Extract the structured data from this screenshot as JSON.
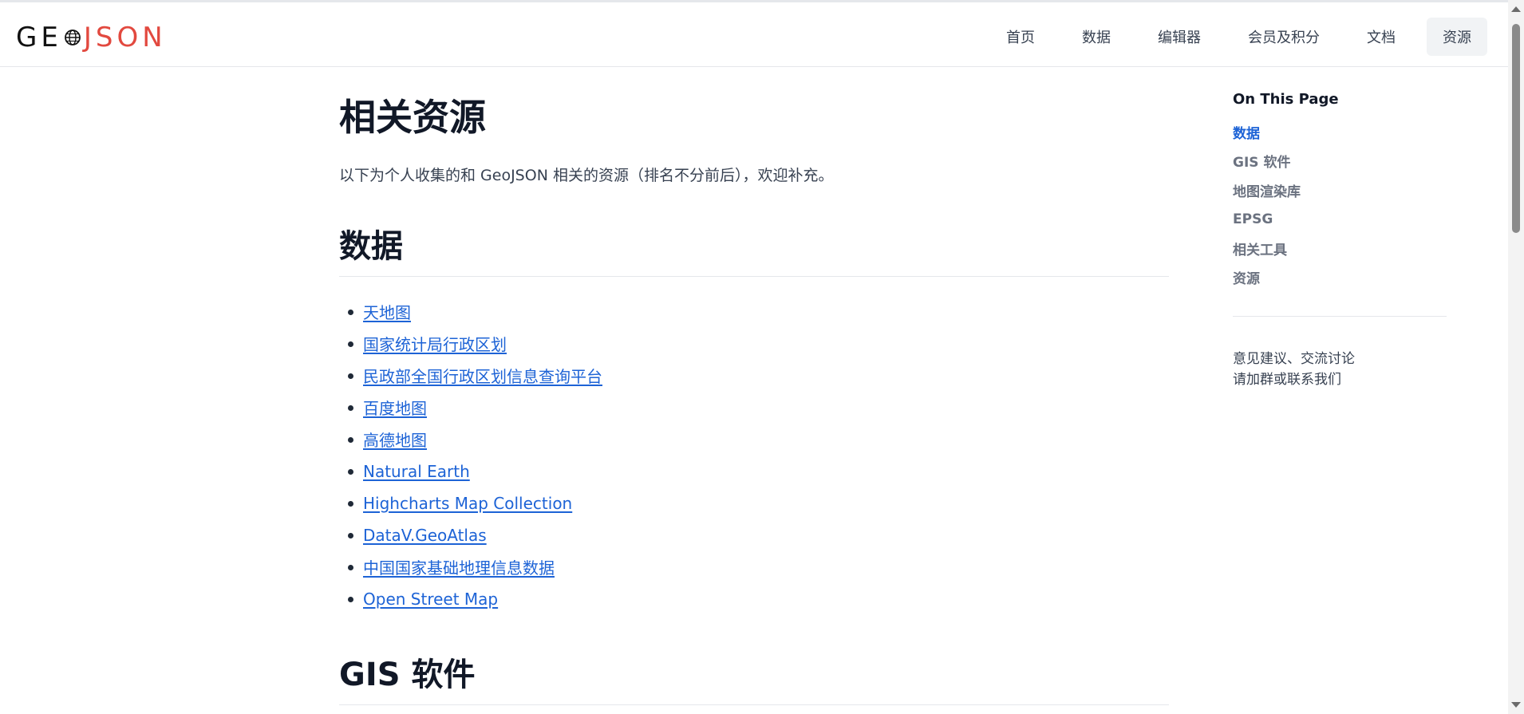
{
  "header": {
    "logo": {
      "part1": "GE",
      "part2": "JSON"
    },
    "nav": [
      {
        "label": "首页",
        "active": false
      },
      {
        "label": "数据",
        "active": false
      },
      {
        "label": "编辑器",
        "active": false
      },
      {
        "label": "会员及积分",
        "active": false
      },
      {
        "label": "文档",
        "active": false
      },
      {
        "label": "资源",
        "active": true
      }
    ]
  },
  "main": {
    "title": "相关资源",
    "intro": "以下为个人收集的和 GeoJSON 相关的资源（排名不分前后），欢迎补充。",
    "sections": [
      {
        "title": "数据",
        "links": [
          "天地图",
          "国家统计局行政区划",
          "民政部全国行政区划信息查询平台",
          "百度地图",
          "高德地图",
          "Natural Earth",
          "Highcharts Map Collection",
          "DataV.GeoAtlas",
          "中国国家基础地理信息数据",
          "Open Street Map"
        ]
      },
      {
        "title": "GIS 软件"
      }
    ]
  },
  "toc": {
    "heading": "On This Page",
    "items": [
      {
        "label": "数据",
        "active": true
      },
      {
        "label": "GIS 软件",
        "active": false
      },
      {
        "label": "地图渲染库",
        "active": false
      },
      {
        "label": "EPSG",
        "active": false
      },
      {
        "label": "相关工具",
        "active": false
      },
      {
        "label": "资源",
        "active": false
      }
    ],
    "note_line1": "意见建议、交流讨论",
    "note_line2": "请加群或联系我们"
  },
  "colors": {
    "accent": "#1d63d6",
    "logo_red": "#e2493f"
  }
}
